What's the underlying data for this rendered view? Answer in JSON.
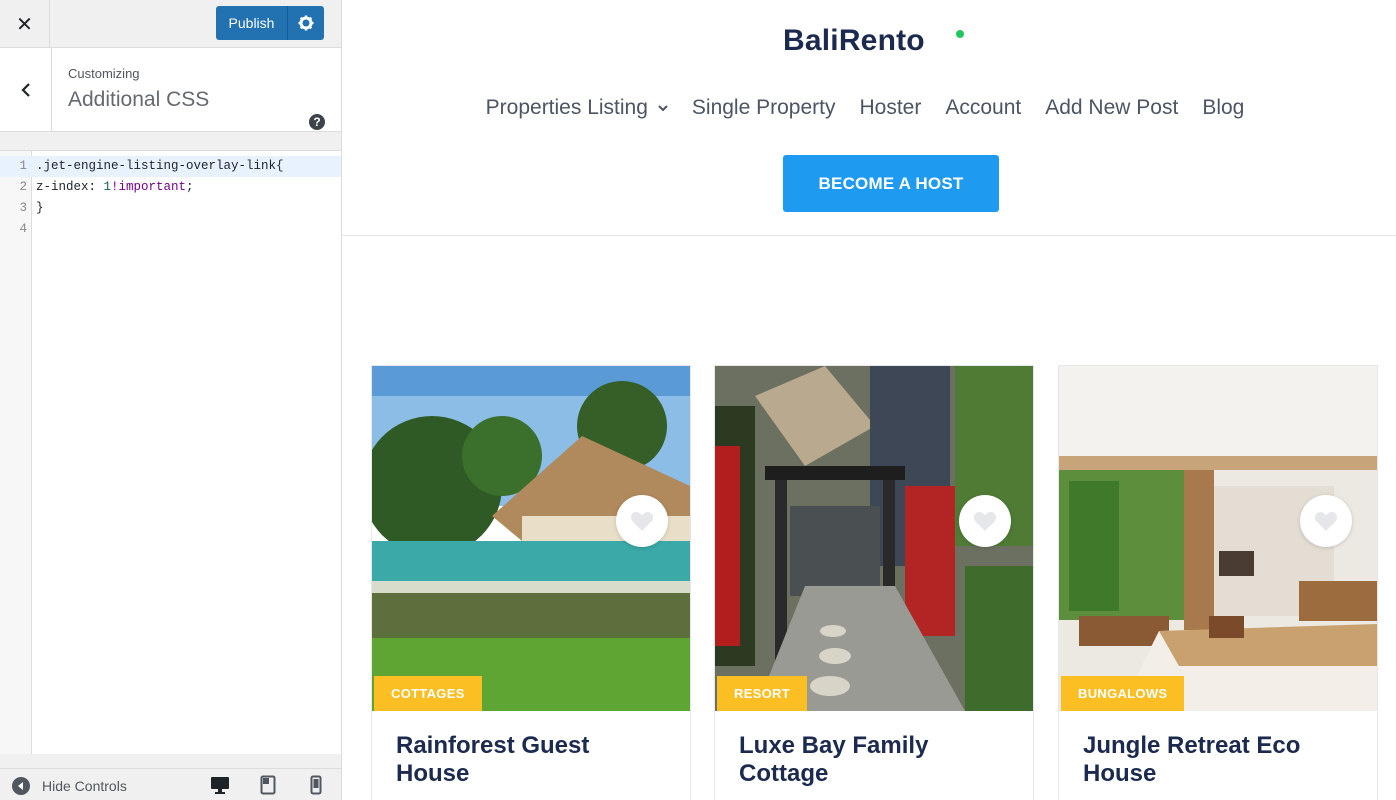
{
  "sidebar": {
    "close_label": "Close",
    "publish_label": "Publish",
    "breadcrumb": "Customizing",
    "section_title": "Additional CSS",
    "code_lines": [
      {
        "num": "1",
        "text": ".jet-engine-listing-overlay-link{"
      },
      {
        "num": "2",
        "text": "z-index: 1!important;"
      },
      {
        "num": "3",
        "text": "}"
      },
      {
        "num": "4",
        "text": ""
      }
    ],
    "hide_controls_label": "Hide Controls",
    "devices": [
      "desktop-icon",
      "tablet-icon",
      "mobile-icon"
    ]
  },
  "site": {
    "logo": "BaliRento",
    "nav": [
      "Properties Listing",
      "Single Property",
      "Hoster",
      "Account",
      "Add New Post",
      "Blog"
    ],
    "cta_label": "BECOME A HOST",
    "colors": {
      "accent": "#1e9bf0",
      "badge": "#fbbf24",
      "logo": "#1b2a4e",
      "logo_dot": "#22c55e"
    }
  },
  "cards": [
    {
      "badge": "COTTAGES",
      "title": "Rainforest Guest House"
    },
    {
      "badge": "RESORT",
      "title": "Luxe Bay Family Cottage"
    },
    {
      "badge": "BUNGALOWS",
      "title": "Jungle Retreat Eco House"
    }
  ]
}
